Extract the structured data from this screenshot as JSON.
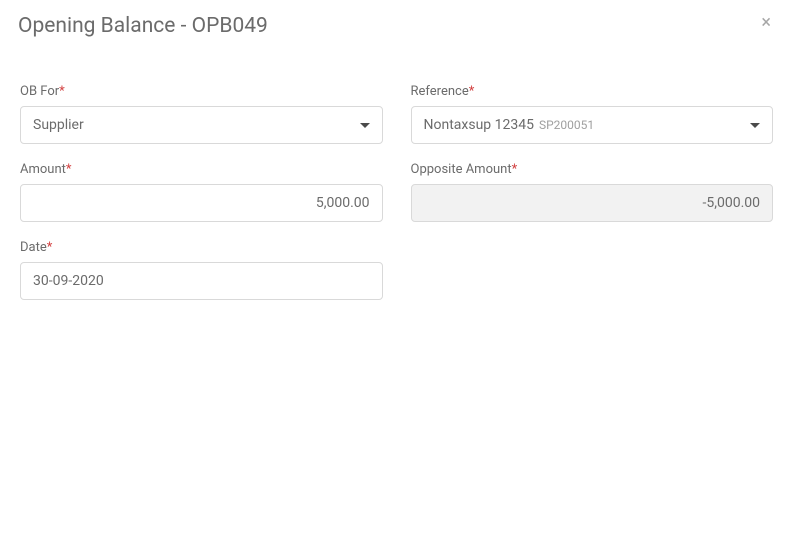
{
  "header": {
    "title": "Opening Balance - OPB049"
  },
  "form": {
    "obFor": {
      "label": "OB For",
      "value": "Supplier"
    },
    "reference": {
      "label": "Reference",
      "valueMain": "Nontaxsup 12345",
      "valueSub": "SP200051"
    },
    "amount": {
      "label": "Amount",
      "value": "5,000.00"
    },
    "oppositeAmount": {
      "label": "Opposite Amount",
      "value": "-5,000.00"
    },
    "date": {
      "label": "Date",
      "value": "30-09-2020"
    },
    "requiredMark": "*"
  }
}
